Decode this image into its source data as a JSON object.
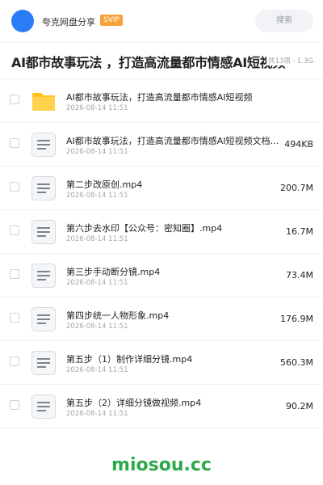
{
  "header": {
    "owner_name": "夸克网盘分享",
    "badge": "SVIP",
    "search_placeholder": "搜索"
  },
  "share": {
    "title": "AI都市故事玩法 ，打造高流量都市情感AI短视频",
    "meta": "共13项 · 1.3G"
  },
  "files": [
    {
      "name": "AI都市故事玩法，打造高流量都市情感AI短视频",
      "date": "2026-08-14 11:51",
      "size": "",
      "icon": "folder-icon"
    },
    {
      "name": "AI都市故事玩法，打造高流量都市情感AI短视频文档…",
      "date": "2026-08-14 11:51",
      "size": "494KB",
      "icon": "file-icon"
    },
    {
      "name": "第二步改原创.mp4",
      "date": "2026-08-14 11:51",
      "size": "200.7M",
      "icon": "file-icon"
    },
    {
      "name": "第六步去水印【公众号：密知圈】.mp4",
      "date": "2026-08-14 11:51",
      "size": "16.7M",
      "icon": "file-icon"
    },
    {
      "name": "第三步手动断分镜.mp4",
      "date": "2026-08-14 11:51",
      "size": "73.4M",
      "icon": "file-icon"
    },
    {
      "name": "第四步统一人物形象.mp4",
      "date": "2026-08-14 11:51",
      "size": "176.9M",
      "icon": "file-icon"
    },
    {
      "name": "第五步（1）制作详细分镜.mp4",
      "date": "2026-08-14 11:51",
      "size": "560.3M",
      "icon": "file-icon"
    },
    {
      "name": "第五步（2）详细分镜做视频.mp4",
      "date": "2026-08-14 11:51",
      "size": "90.2M",
      "icon": "file-icon"
    }
  ],
  "watermark": "miosou.cc",
  "colors": {
    "avatar": "#2b7cf6",
    "badge": "#f7a13b",
    "folder": "#ffc41f",
    "watermark": "#2ea84a"
  }
}
